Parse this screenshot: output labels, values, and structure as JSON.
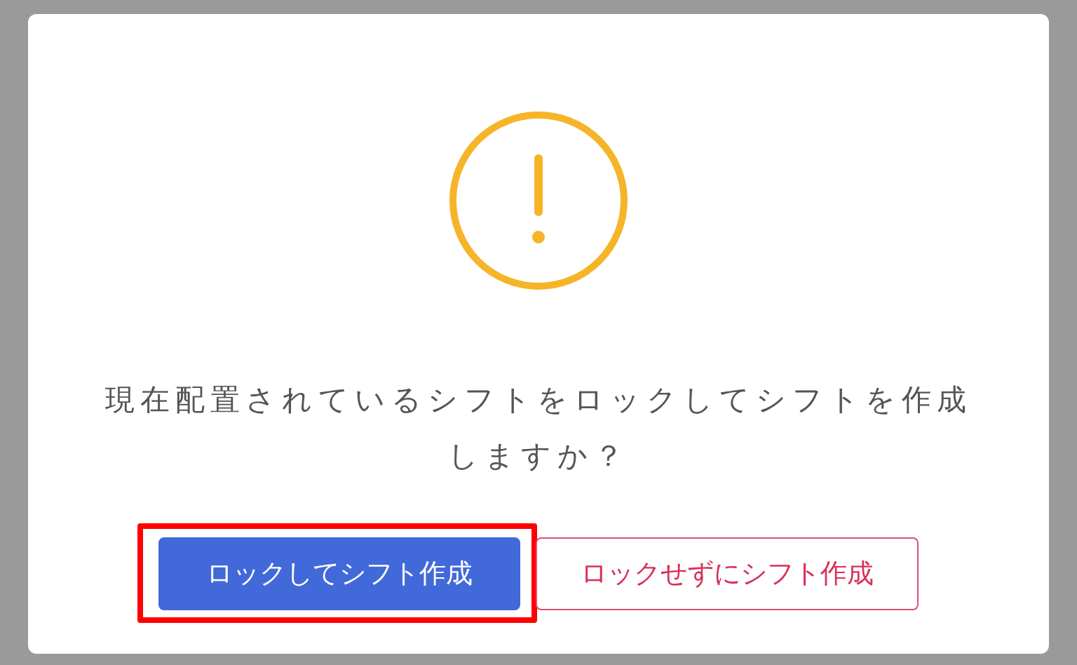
{
  "dialog": {
    "message": "現在配置されているシフトをロックしてシフトを作成しますか？",
    "buttons": [
      {
        "label": "ロックしてシフト作成",
        "kind": "primary",
        "highlighted": true
      },
      {
        "label": "ロックせずにシフト作成",
        "kind": "outline",
        "highlighted": false
      }
    ]
  }
}
